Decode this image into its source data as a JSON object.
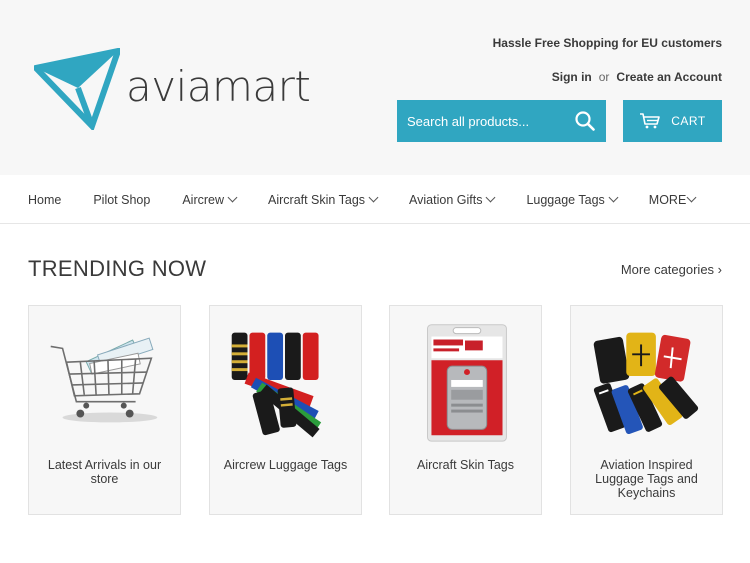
{
  "header": {
    "logo_text": "aviamart",
    "promo": "Hassle Free Shopping for EU customers",
    "sign_in": "Sign in",
    "or": "or",
    "create_account": "Create an Account",
    "search_placeholder": "Search all products...",
    "cart_label": "CART"
  },
  "nav": {
    "items": [
      {
        "label": "Home",
        "dropdown": false
      },
      {
        "label": "Pilot Shop",
        "dropdown": false
      },
      {
        "label": "Aircrew",
        "dropdown": true
      },
      {
        "label": "Aircraft Skin Tags",
        "dropdown": true
      },
      {
        "label": "Aviation Gifts",
        "dropdown": true
      },
      {
        "label": "Luggage Tags",
        "dropdown": true
      },
      {
        "label": "MORE",
        "dropdown": true
      }
    ]
  },
  "trending": {
    "title": "TRENDING NOW",
    "more": "More categories ›",
    "cards": [
      {
        "label": "Latest Arrivals in our store",
        "icon": "shopping-cart-image"
      },
      {
        "label": "Aircrew Luggage Tags",
        "icon": "crew-tags-image"
      },
      {
        "label": "Aircraft Skin Tags",
        "icon": "skin-tag-image"
      },
      {
        "label": "Aviation Inspired Luggage Tags and Keychains",
        "icon": "keychains-image"
      }
    ]
  },
  "colors": {
    "accent": "#30a6c1",
    "header_bg": "#f7f7f7",
    "text": "#3a3a3a"
  }
}
